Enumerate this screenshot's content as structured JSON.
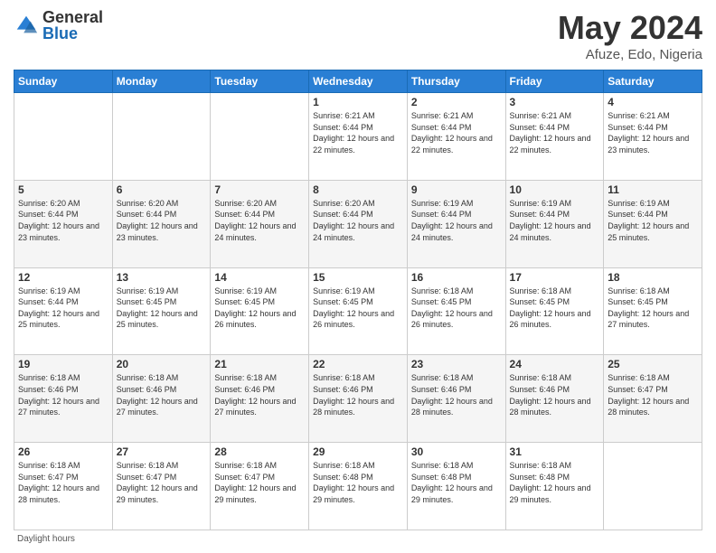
{
  "header": {
    "logo_general": "General",
    "logo_blue": "Blue",
    "month": "May 2024",
    "location": "Afuze, Edo, Nigeria"
  },
  "days_of_week": [
    "Sunday",
    "Monday",
    "Tuesday",
    "Wednesday",
    "Thursday",
    "Friday",
    "Saturday"
  ],
  "weeks": [
    {
      "days": [
        {
          "number": "",
          "info": ""
        },
        {
          "number": "",
          "info": ""
        },
        {
          "number": "",
          "info": ""
        },
        {
          "number": "1",
          "info": "Sunrise: 6:21 AM\nSunset: 6:44 PM\nDaylight: 12 hours and 22 minutes."
        },
        {
          "number": "2",
          "info": "Sunrise: 6:21 AM\nSunset: 6:44 PM\nDaylight: 12 hours and 22 minutes."
        },
        {
          "number": "3",
          "info": "Sunrise: 6:21 AM\nSunset: 6:44 PM\nDaylight: 12 hours and 22 minutes."
        },
        {
          "number": "4",
          "info": "Sunrise: 6:21 AM\nSunset: 6:44 PM\nDaylight: 12 hours and 23 minutes."
        }
      ]
    },
    {
      "days": [
        {
          "number": "5",
          "info": "Sunrise: 6:20 AM\nSunset: 6:44 PM\nDaylight: 12 hours and 23 minutes."
        },
        {
          "number": "6",
          "info": "Sunrise: 6:20 AM\nSunset: 6:44 PM\nDaylight: 12 hours and 23 minutes."
        },
        {
          "number": "7",
          "info": "Sunrise: 6:20 AM\nSunset: 6:44 PM\nDaylight: 12 hours and 24 minutes."
        },
        {
          "number": "8",
          "info": "Sunrise: 6:20 AM\nSunset: 6:44 PM\nDaylight: 12 hours and 24 minutes."
        },
        {
          "number": "9",
          "info": "Sunrise: 6:19 AM\nSunset: 6:44 PM\nDaylight: 12 hours and 24 minutes."
        },
        {
          "number": "10",
          "info": "Sunrise: 6:19 AM\nSunset: 6:44 PM\nDaylight: 12 hours and 24 minutes."
        },
        {
          "number": "11",
          "info": "Sunrise: 6:19 AM\nSunset: 6:44 PM\nDaylight: 12 hours and 25 minutes."
        }
      ]
    },
    {
      "days": [
        {
          "number": "12",
          "info": "Sunrise: 6:19 AM\nSunset: 6:44 PM\nDaylight: 12 hours and 25 minutes."
        },
        {
          "number": "13",
          "info": "Sunrise: 6:19 AM\nSunset: 6:45 PM\nDaylight: 12 hours and 25 minutes."
        },
        {
          "number": "14",
          "info": "Sunrise: 6:19 AM\nSunset: 6:45 PM\nDaylight: 12 hours and 26 minutes."
        },
        {
          "number": "15",
          "info": "Sunrise: 6:19 AM\nSunset: 6:45 PM\nDaylight: 12 hours and 26 minutes."
        },
        {
          "number": "16",
          "info": "Sunrise: 6:18 AM\nSunset: 6:45 PM\nDaylight: 12 hours and 26 minutes."
        },
        {
          "number": "17",
          "info": "Sunrise: 6:18 AM\nSunset: 6:45 PM\nDaylight: 12 hours and 26 minutes."
        },
        {
          "number": "18",
          "info": "Sunrise: 6:18 AM\nSunset: 6:45 PM\nDaylight: 12 hours and 27 minutes."
        }
      ]
    },
    {
      "days": [
        {
          "number": "19",
          "info": "Sunrise: 6:18 AM\nSunset: 6:46 PM\nDaylight: 12 hours and 27 minutes."
        },
        {
          "number": "20",
          "info": "Sunrise: 6:18 AM\nSunset: 6:46 PM\nDaylight: 12 hours and 27 minutes."
        },
        {
          "number": "21",
          "info": "Sunrise: 6:18 AM\nSunset: 6:46 PM\nDaylight: 12 hours and 27 minutes."
        },
        {
          "number": "22",
          "info": "Sunrise: 6:18 AM\nSunset: 6:46 PM\nDaylight: 12 hours and 28 minutes."
        },
        {
          "number": "23",
          "info": "Sunrise: 6:18 AM\nSunset: 6:46 PM\nDaylight: 12 hours and 28 minutes."
        },
        {
          "number": "24",
          "info": "Sunrise: 6:18 AM\nSunset: 6:46 PM\nDaylight: 12 hours and 28 minutes."
        },
        {
          "number": "25",
          "info": "Sunrise: 6:18 AM\nSunset: 6:47 PM\nDaylight: 12 hours and 28 minutes."
        }
      ]
    },
    {
      "days": [
        {
          "number": "26",
          "info": "Sunrise: 6:18 AM\nSunset: 6:47 PM\nDaylight: 12 hours and 28 minutes."
        },
        {
          "number": "27",
          "info": "Sunrise: 6:18 AM\nSunset: 6:47 PM\nDaylight: 12 hours and 29 minutes."
        },
        {
          "number": "28",
          "info": "Sunrise: 6:18 AM\nSunset: 6:47 PM\nDaylight: 12 hours and 29 minutes."
        },
        {
          "number": "29",
          "info": "Sunrise: 6:18 AM\nSunset: 6:48 PM\nDaylight: 12 hours and 29 minutes."
        },
        {
          "number": "30",
          "info": "Sunrise: 6:18 AM\nSunset: 6:48 PM\nDaylight: 12 hours and 29 minutes."
        },
        {
          "number": "31",
          "info": "Sunrise: 6:18 AM\nSunset: 6:48 PM\nDaylight: 12 hours and 29 minutes."
        },
        {
          "number": "",
          "info": ""
        }
      ]
    }
  ],
  "footer": "Daylight hours"
}
